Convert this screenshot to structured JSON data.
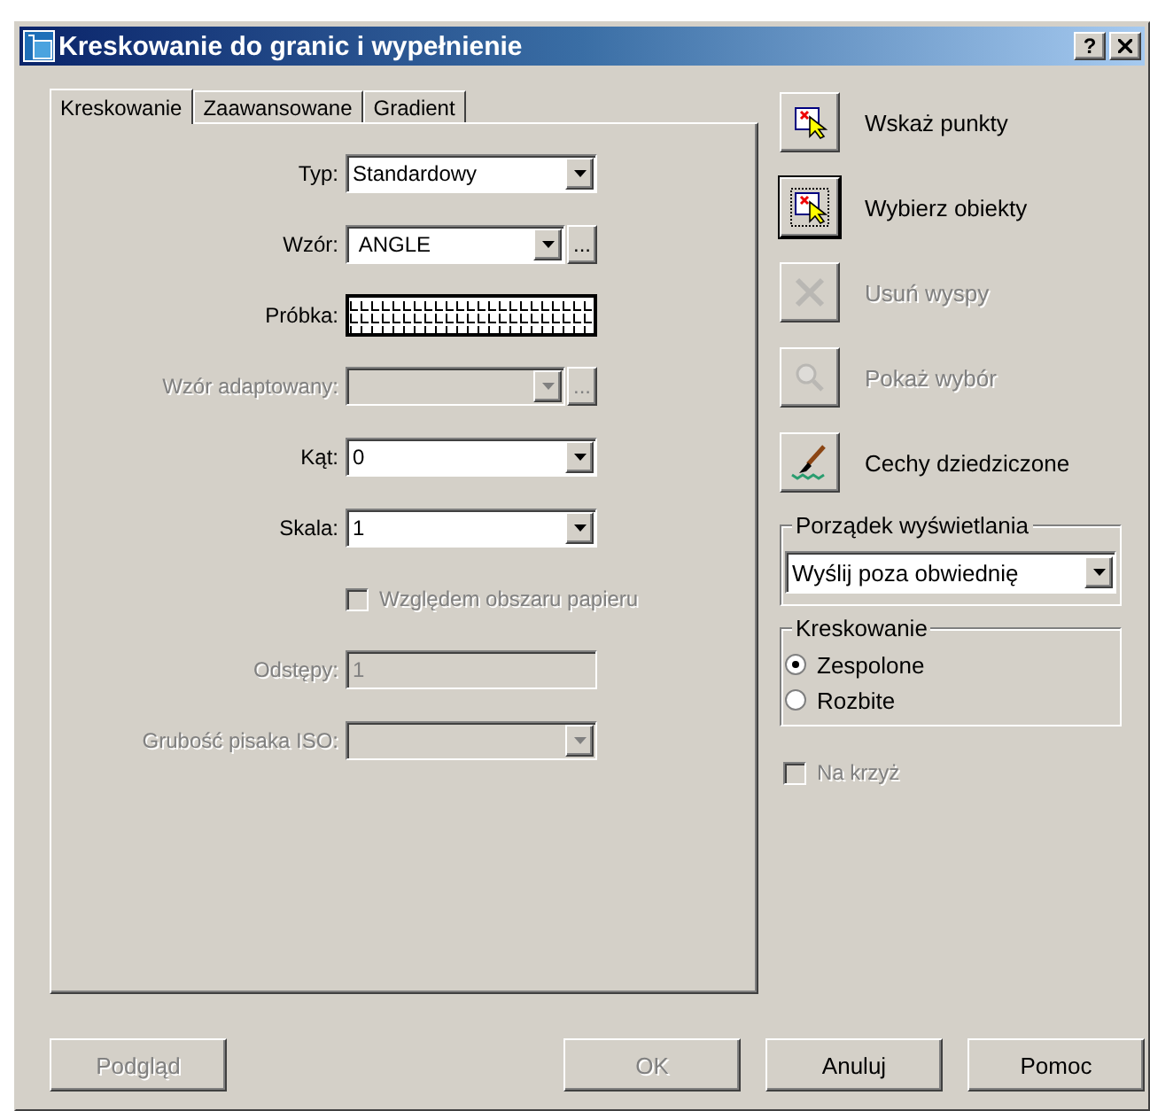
{
  "window": {
    "title": "Kreskowanie do granic i wypełnienie",
    "help": "?"
  },
  "tabs": [
    {
      "label": "Kreskowanie",
      "selected": true
    },
    {
      "label": "Zaawansowane",
      "selected": false
    },
    {
      "label": "Gradient",
      "selected": false
    }
  ],
  "fields": [
    {
      "kind": "combo",
      "label": "Typ:",
      "value": "Standardowy",
      "disabled": false
    },
    {
      "kind": "browse",
      "label": "Wzór:",
      "value": "ANGLE",
      "browse": "...",
      "disabled": false
    },
    {
      "kind": "sample",
      "label": "Próbka:",
      "disabled": false
    },
    {
      "kind": "browse",
      "label": "Wzór adaptowany:",
      "browse": "...",
      "disabled": true
    },
    {
      "kind": "combo",
      "label": "Kąt:",
      "value": "0",
      "disabled": false
    },
    {
      "kind": "combo",
      "label": "Skala:",
      "value": "1",
      "disabled": false
    },
    {
      "kind": "checkbox",
      "label": "Względem obszaru papieru",
      "checked": false,
      "disabled": true
    },
    {
      "kind": "text",
      "label": "Odstępy:",
      "value": "1",
      "disabled": true
    },
    {
      "kind": "combo",
      "label": "Grubość pisaka ISO:",
      "disabled": true
    }
  ],
  "actions": [
    {
      "kind": "pick",
      "label": "Wskaż punkty",
      "disabled": false,
      "focused": false
    },
    {
      "kind": "select",
      "label": "Wybierz obiekty",
      "disabled": false,
      "focused": true
    },
    {
      "kind": "remove",
      "label": "Usuń wyspy",
      "disabled": true,
      "focused": false
    },
    {
      "kind": "view",
      "label": "Pokaż wybór",
      "disabled": true,
      "focused": false
    },
    {
      "kind": "inherit",
      "label": "Cechy dziedziczone",
      "disabled": false,
      "focused": false
    }
  ],
  "draw_order": {
    "title": "Porządek wyświetlania",
    "value": "Wyślij poza obwiednię"
  },
  "hatching": {
    "title": "Kreskowanie",
    "options": [
      {
        "label": "Zespolone",
        "selected": true
      },
      {
        "label": "Rozbite",
        "selected": false
      }
    ]
  },
  "cross": {
    "label": "Na krzyż",
    "checked": false,
    "disabled": true
  },
  "buttons": [
    {
      "label": "Podgląd",
      "disabled": true
    },
    {
      "label": "OK",
      "disabled": true
    },
    {
      "label": "Anuluj",
      "disabled": false
    },
    {
      "label": "Pomoc",
      "disabled": false
    }
  ]
}
